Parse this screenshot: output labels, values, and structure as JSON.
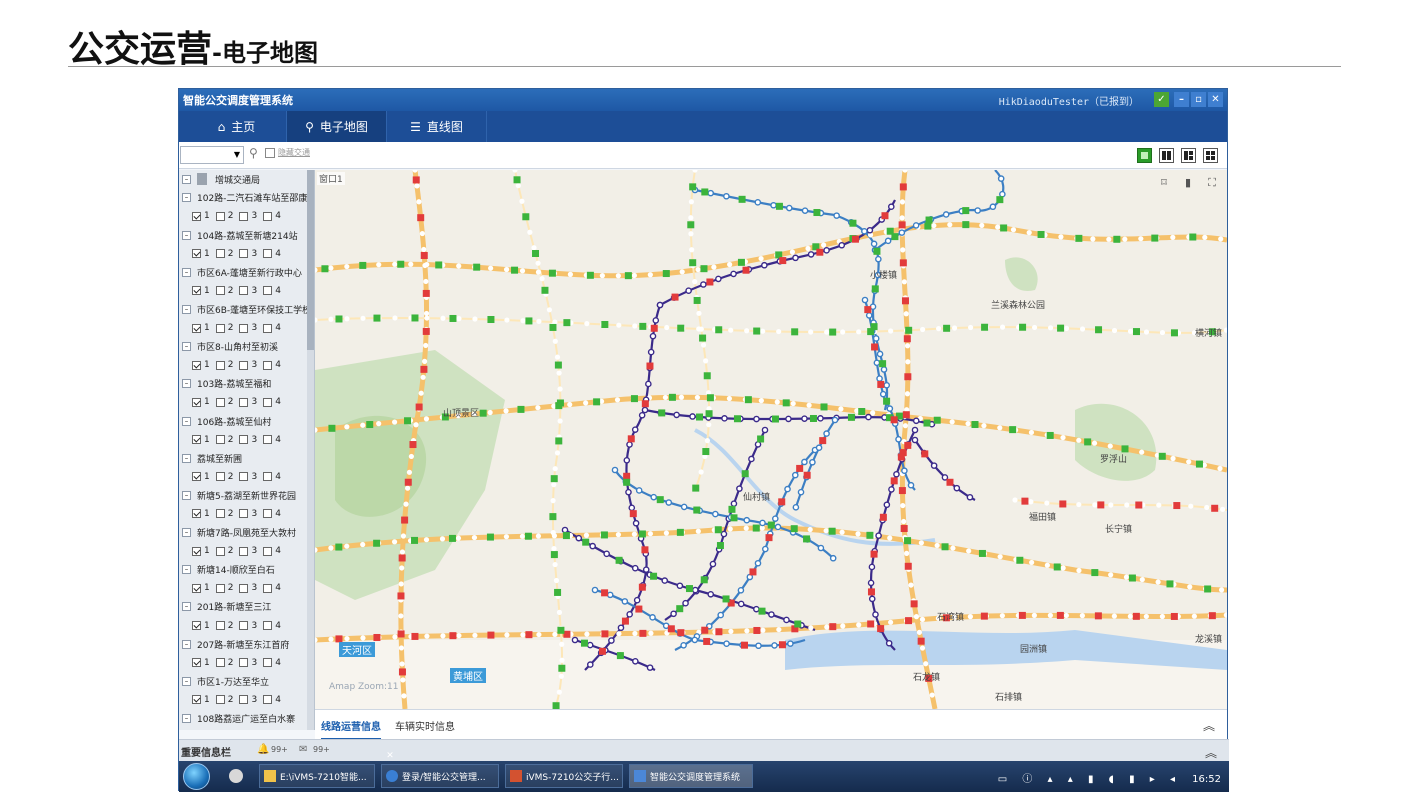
{
  "slide": {
    "title_main": "公交运营",
    "title_sub": "-电子地图"
  },
  "app": {
    "window_title": "智能公交调度管理系统",
    "user_status": "HikDiaoduTester（已报到）",
    "nav_tabs": [
      {
        "label": "主页",
        "icon": "home-icon"
      },
      {
        "label": "电子地图",
        "icon": "map-pin-icon"
      },
      {
        "label": "直线图",
        "icon": "line-diagram-icon"
      }
    ],
    "active_tab": 1,
    "toolbar": {
      "filter_checkbox_label": "隐藏交通"
    },
    "tree": {
      "root": "增城交通局",
      "routes": [
        "102路-二汽石滩车站至邵康庄",
        "104路-荔城至新塘214站",
        "市区6A-蓬塘至新行政中心",
        "市区6B-蓬塘至环保技工学校",
        "市区8-山角村至初溪",
        "103路-荔城至福和",
        "106路-荔城至仙村",
        "荔城至新圃",
        "新塘5-荔湖至新世界花园",
        "新塘7路-凤凰苑至大敦村",
        "新塘14-顺欣至白石",
        "201路-新塘至三江",
        "207路-新塘至东江首府",
        "市区1-万达至华立",
        "108路荔运广运至白水寨"
      ],
      "options": [
        "1",
        "2",
        "3",
        "4"
      ]
    },
    "map": {
      "window_label": "窗口1",
      "places": [
        {
          "name": "兰溪森林公园"
        },
        {
          "name": "横河镇"
        },
        {
          "name": "山顶景区"
        },
        {
          "name": "罗浮山"
        },
        {
          "name": "仙村镇"
        },
        {
          "name": "福田镇"
        },
        {
          "name": "长宁镇"
        },
        {
          "name": "石湾镇"
        },
        {
          "name": "园洲镇"
        },
        {
          "name": "龙溪镇"
        },
        {
          "name": "石龙镇"
        },
        {
          "name": "石排镇"
        },
        {
          "name": "天河区"
        },
        {
          "name": "黄埔区"
        },
        {
          "name": "小楼镇"
        }
      ],
      "watermark": "Amap Zoom:11"
    },
    "bottom_tabs": [
      "线路运营信息",
      "车辆实时信息"
    ],
    "info_bar": {
      "label": "重要信息栏",
      "count_a": "99+",
      "count_b": "99+"
    },
    "taskbar": {
      "items": [
        "E:\\iVMS-7210智能...",
        "登录/智能公交管理...",
        "iVMS-7210公交子行...",
        "智能公交调度管理系统"
      ],
      "clock": "16:52"
    }
  },
  "colors": {
    "titlebar": "#1e58a5",
    "navbar": "#1d4e97",
    "route_primary": "#3b2a8a",
    "route_secondary": "#3c7fc4",
    "bus_red": "#e23b3b",
    "bus_green": "#3cb43c"
  }
}
